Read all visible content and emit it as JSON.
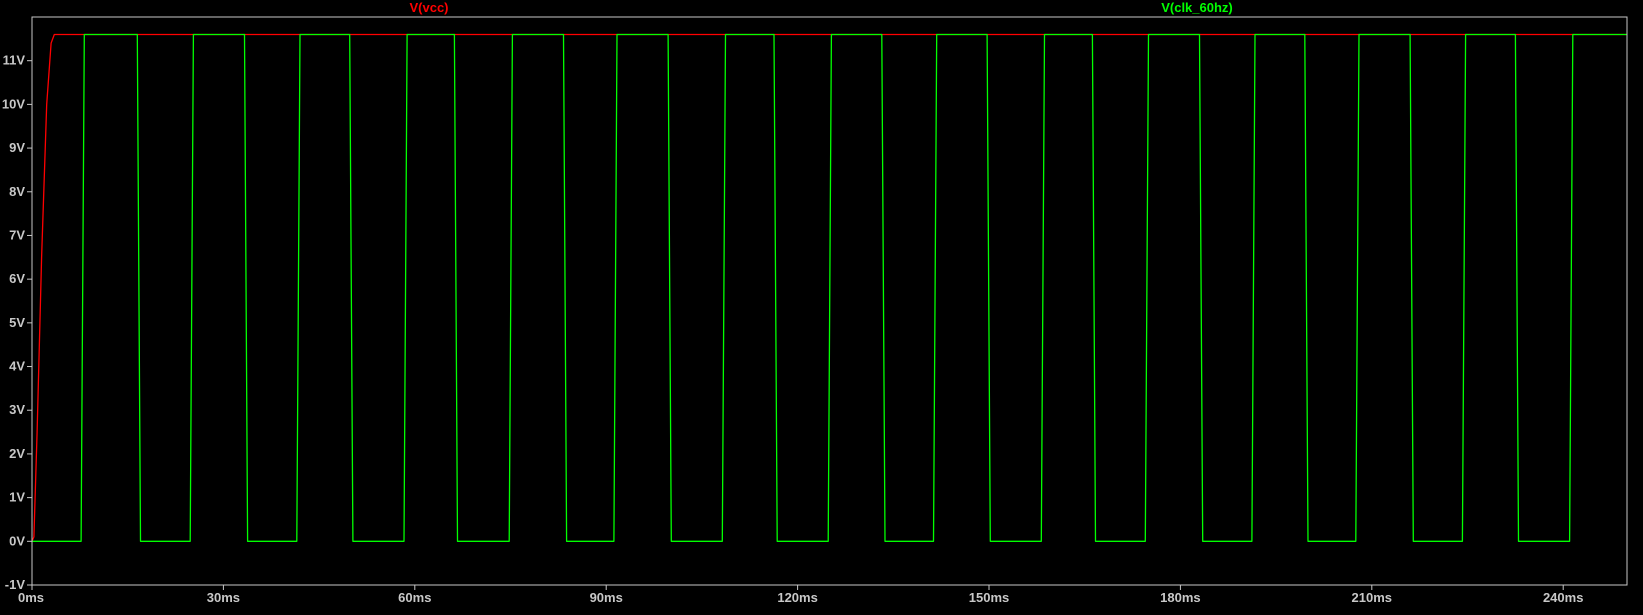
{
  "chart_data": {
    "type": "line",
    "title": "",
    "xlabel": "",
    "ylabel": "",
    "xlim": [
      0,
      250
    ],
    "ylim": [
      -1,
      12
    ],
    "x_unit": "ms",
    "y_unit": "V",
    "grid": false,
    "background_color": "#000000",
    "axis_color": "#c8c8c8",
    "x_ticks": [
      {
        "value": 0,
        "label": "0ms"
      },
      {
        "value": 30,
        "label": "30ms"
      },
      {
        "value": 60,
        "label": "60ms"
      },
      {
        "value": 90,
        "label": "90ms"
      },
      {
        "value": 120,
        "label": "120ms"
      },
      {
        "value": 150,
        "label": "150ms"
      },
      {
        "value": 180,
        "label": "180ms"
      },
      {
        "value": 210,
        "label": "210ms"
      },
      {
        "value": 240,
        "label": "240ms"
      }
    ],
    "y_ticks": [
      {
        "value": -1,
        "label": "-1V"
      },
      {
        "value": 0,
        "label": "0V"
      },
      {
        "value": 1,
        "label": "1V"
      },
      {
        "value": 2,
        "label": "2V"
      },
      {
        "value": 3,
        "label": "3V"
      },
      {
        "value": 4,
        "label": "4V"
      },
      {
        "value": 5,
        "label": "5V"
      },
      {
        "value": 6,
        "label": "6V"
      },
      {
        "value": 7,
        "label": "7V"
      },
      {
        "value": 8,
        "label": "8V"
      },
      {
        "value": 9,
        "label": "9V"
      },
      {
        "value": 10,
        "label": "10V"
      },
      {
        "value": 11,
        "label": "11V"
      }
    ],
    "series": [
      {
        "name": "V(vcc)",
        "color": "#ff0000",
        "x": [
          0,
          0.3,
          0.8,
          1.5,
          2.3,
          3.0,
          3.5,
          250
        ],
        "y": [
          0,
          0.1,
          2.5,
          6.5,
          10.0,
          11.4,
          11.6,
          11.6
        ]
      },
      {
        "name": "V(clk_60hz)",
        "color": "#00ff00",
        "x": [
          0,
          7.7,
          8.2,
          16.5,
          17.0,
          24.8,
          25.3,
          33.3,
          33.8,
          41.5,
          42.0,
          49.8,
          50.3,
          58.3,
          58.8,
          66.2,
          66.7,
          74.8,
          75.3,
          83.3,
          83.8,
          91.2,
          91.7,
          99.7,
          100.2,
          108.2,
          108.7,
          116.3,
          116.8,
          124.8,
          125.3,
          133.2,
          133.7,
          141.3,
          141.8,
          149.7,
          150.2,
          158.2,
          158.7,
          166.2,
          166.7,
          174.5,
          175.0,
          183.0,
          183.5,
          191.2,
          191.7,
          199.5,
          200.0,
          207.5,
          208.0,
          216.0,
          216.5,
          224.2,
          224.7,
          232.5,
          233.0,
          241.0,
          241.5,
          250
        ],
        "y": [
          0,
          0,
          11.6,
          11.6,
          0,
          0,
          11.6,
          11.6,
          0,
          0,
          11.6,
          11.6,
          0,
          0,
          11.6,
          11.6,
          0,
          0,
          11.6,
          11.6,
          0,
          0,
          11.6,
          11.6,
          0,
          0,
          11.6,
          11.6,
          0,
          0,
          11.6,
          11.6,
          0,
          0,
          11.6,
          11.6,
          0,
          0,
          11.6,
          11.6,
          0,
          0,
          11.6,
          11.6,
          0,
          0,
          11.6,
          11.6,
          0,
          0,
          11.6,
          11.6,
          0,
          0,
          11.6,
          11.6,
          0,
          0,
          11.6,
          11.6
        ]
      }
    ]
  }
}
